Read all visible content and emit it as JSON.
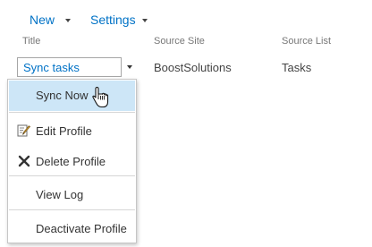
{
  "toolbar": {
    "new_label": "New",
    "settings_label": "Settings"
  },
  "columns": {
    "title": "Title",
    "source_site": "Source Site",
    "source_list": "Source List"
  },
  "row": {
    "title": "Sync tasks",
    "source_site": "BoostSolutions",
    "source_list": "Tasks"
  },
  "menu": {
    "items": [
      {
        "label": "Sync Now",
        "icon": null,
        "highlighted": true
      },
      {
        "label": "Edit Profile",
        "icon": "edit-pencil-icon"
      },
      {
        "label": "Delete Profile",
        "icon": "delete-x-icon"
      },
      {
        "label": "View Log",
        "icon": null
      },
      {
        "label": "Deactivate Profile",
        "icon": null
      }
    ]
  },
  "colors": {
    "link": "#0072c6",
    "hover": "#cde6f7"
  }
}
